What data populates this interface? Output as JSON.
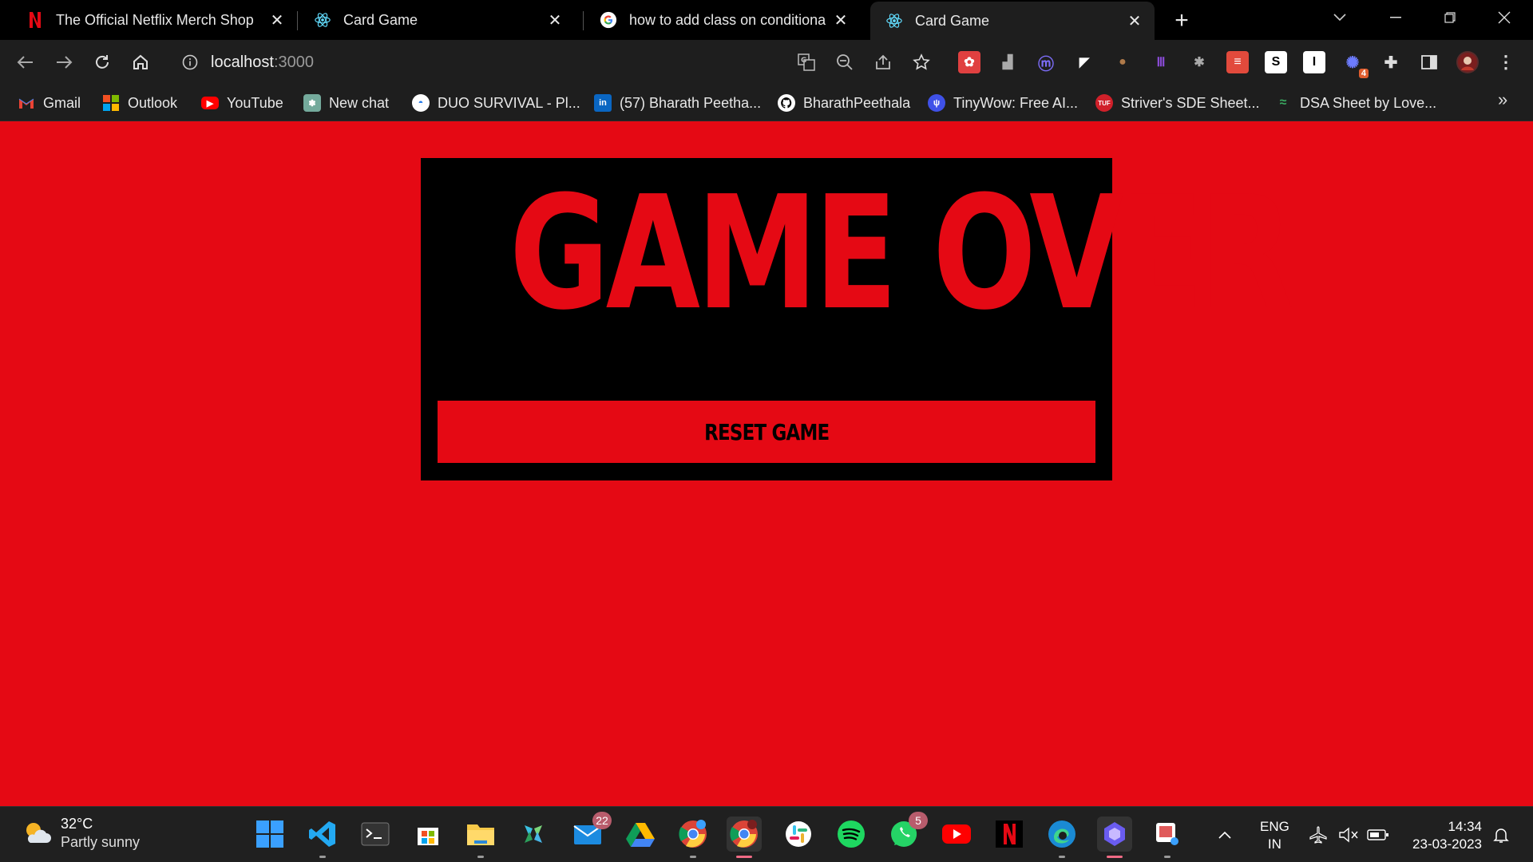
{
  "browser": {
    "tabs": [
      {
        "title": "The Official Netflix Merch Shop",
        "icon": "netflix-icon",
        "active": false
      },
      {
        "title": "Card Game",
        "icon": "react-icon",
        "active": false
      },
      {
        "title": "how to add class on conditional r",
        "icon": "google-icon",
        "active": false
      },
      {
        "title": "Card Game",
        "icon": "react-icon",
        "active": true
      }
    ],
    "close_glyph": "✕",
    "new_tab_glyph": "+",
    "address": {
      "host": "localhost",
      "port": ":3000"
    },
    "bookmarks": [
      {
        "label": "Gmail",
        "icon": "gmail-icon"
      },
      {
        "label": "Outlook",
        "icon": "microsoft-icon"
      },
      {
        "label": "YouTube",
        "icon": "youtube-icon"
      },
      {
        "label": "New chat",
        "icon": "openai-icon"
      },
      {
        "label": "DUO SURVIVAL - Pl...",
        "icon": "duo-icon"
      },
      {
        "label": "(57) Bharath Peetha...",
        "icon": "linkedin-icon"
      },
      {
        "label": "BharathPeethala",
        "icon": "github-icon"
      },
      {
        "label": "TinyWow: Free AI...",
        "icon": "tinywow-icon"
      },
      {
        "label": "Striver's SDE Sheet...",
        "icon": "tuf-icon"
      },
      {
        "label": "DSA Sheet by Love...",
        "icon": "dsa-icon"
      }
    ],
    "bookmarks_more": "»",
    "extension_badge": "4"
  },
  "game": {
    "heading": "GAME OVER",
    "reset_button": "RESET GAME"
  },
  "taskbar": {
    "weather": {
      "temp": "32°C",
      "desc": "Partly sunny"
    },
    "mail_badge": "22",
    "whatsapp_badge": "5",
    "lang_line1": "ENG",
    "lang_line2": "IN",
    "time": "14:34",
    "date": "23-03-2023"
  },
  "colors": {
    "page_bg": "#e50914",
    "card_bg": "#000000",
    "heading": "#e50914",
    "button_bg": "#e50914",
    "button_text": "#000000"
  }
}
